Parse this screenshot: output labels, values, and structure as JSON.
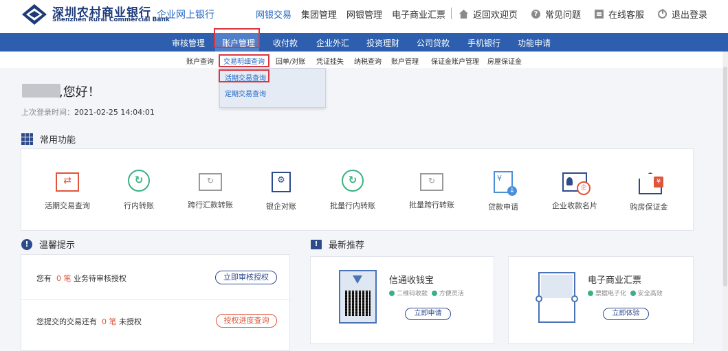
{
  "brand": {
    "name_cn": "深圳农村商业银行",
    "name_en": "Shenzhen Rural Commercial Bank",
    "portal": "企业网上银行"
  },
  "top_nav": {
    "items": [
      "网银交易",
      "集团管理",
      "网银管理",
      "电子商业汇票"
    ],
    "active": "网银交易",
    "right": [
      "返回欢迎页",
      "常见问题",
      "在线客服",
      "退出登录"
    ]
  },
  "main_nav": {
    "items": [
      "审核管理",
      "账户管理",
      "收付款",
      "企业外汇",
      "投资理财",
      "公司贷款",
      "手机银行",
      "功能申请"
    ],
    "active": "账户管理"
  },
  "sub_nav": {
    "items": [
      "账户查询",
      "交易明细查询",
      "回单/对账",
      "凭证挂失",
      "纳税查询",
      "账户管理",
      "保证金账户管理",
      "房屋保证金"
    ]
  },
  "dropdown": {
    "items": [
      "活期交易查询",
      "定期交易查询"
    ]
  },
  "welcome": {
    "greeting": ",您好！",
    "last_login_label": "上次登录时间：",
    "last_login_time": "2021-02-25 14:04:01"
  },
  "common_functions": {
    "title": "常用功能",
    "items": [
      "活期交易查询",
      "行内转账",
      "跨行汇款转账",
      "银企对账",
      "批量行内转账",
      "批量跨行转账",
      "贷款申请",
      "企业收款名片",
      "购房保证金"
    ],
    "icons": [
      "transfer-icon",
      "cycle-icon",
      "tray-transfer-icon",
      "safe-icon",
      "cycle-icon",
      "tray-transfer-icon",
      "loan-doc-icon",
      "card-icon",
      "house-icon"
    ]
  },
  "tips": {
    "title": "温馨提示",
    "row1": {
      "prefix": "您有",
      "count": "0 笔",
      "suffix": "业务待审核授权",
      "button": "立即审核授权"
    },
    "row2": {
      "prefix": "您提交的交易还有",
      "count": "0 笔",
      "suffix": "未授权",
      "button": "授权进度查询"
    }
  },
  "recommend": {
    "title": "最新推荐",
    "cards": [
      {
        "title": "信通收钱宝",
        "features": [
          "二维码收款",
          "方便灵活"
        ],
        "button": "立即申请"
      },
      {
        "title": "电子商业汇票",
        "features": [
          "票据电子化",
          "安全高效"
        ],
        "button": "立即体验"
      }
    ]
  },
  "colors": {
    "nav_blue": "#2d5fae",
    "brand_blue": "#2569c3",
    "accent_orange": "#e0553a",
    "highlight_red": "#d9363e"
  }
}
